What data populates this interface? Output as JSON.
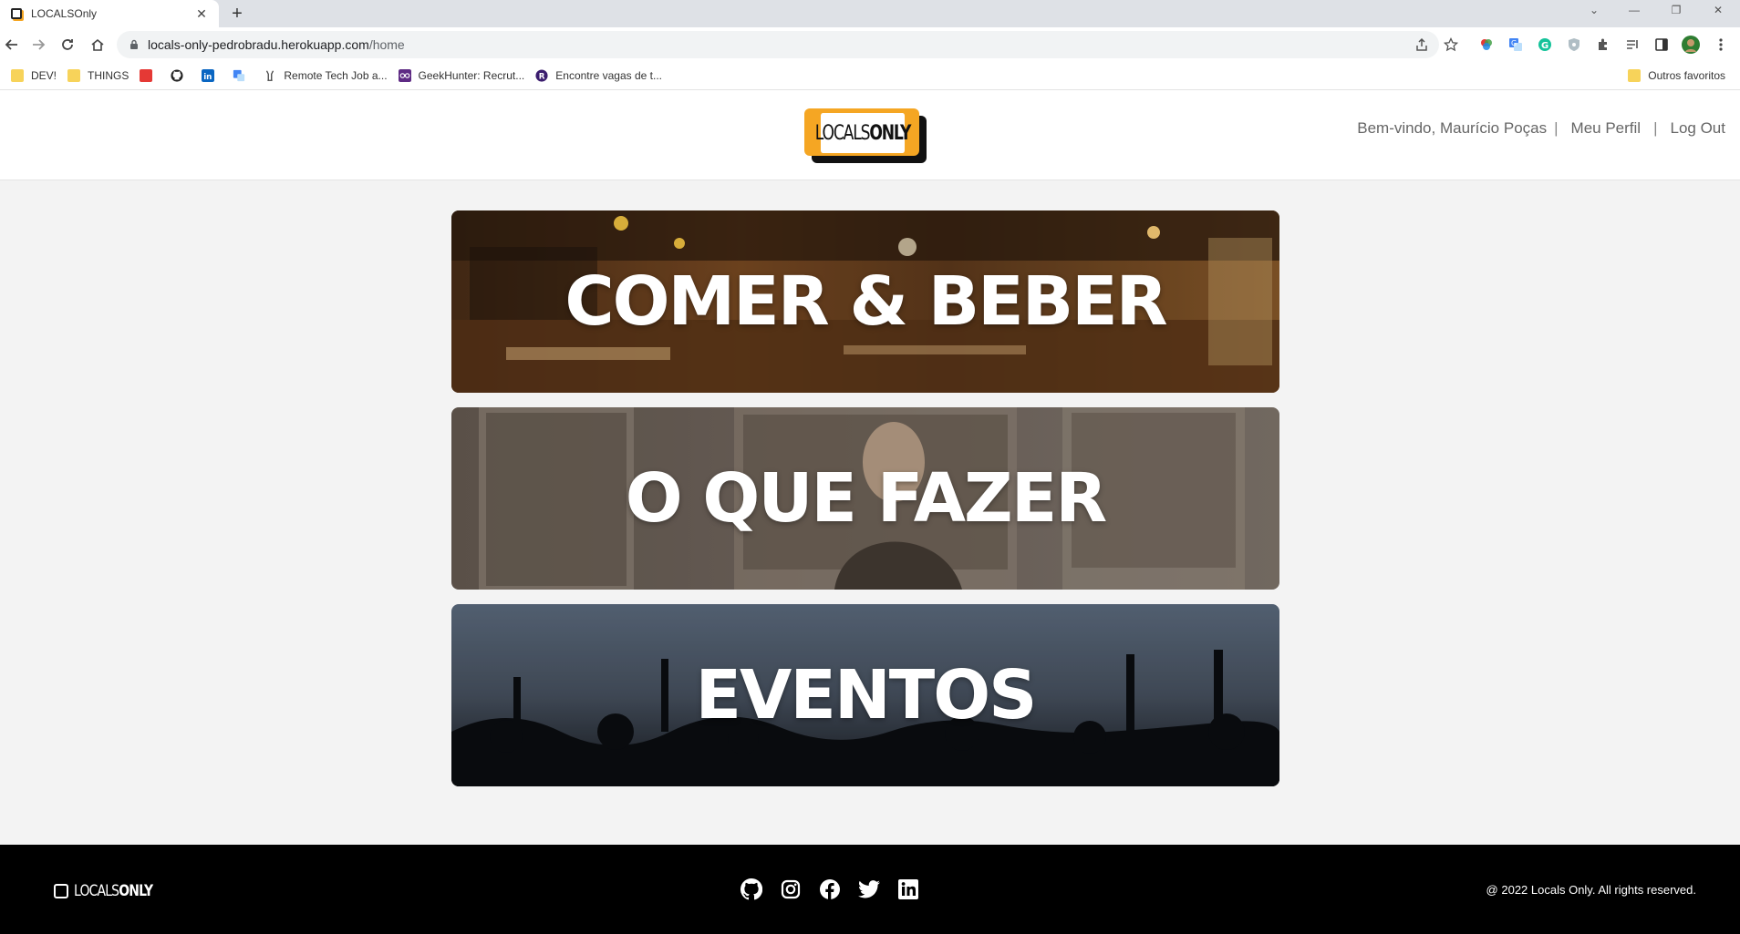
{
  "browser": {
    "tab_title": "LOCALSOnly",
    "url_host": "locals-only-pedrobradu.herokuapp.com",
    "url_path": "/home",
    "bookmarks": [
      {
        "label": "DEV!",
        "icon": "folder-icon"
      },
      {
        "label": "THINGS",
        "icon": "folder-icon"
      },
      {
        "label": "",
        "icon": "red-app-icon"
      },
      {
        "label": "",
        "icon": "github-icon"
      },
      {
        "label": "",
        "icon": "linkedin-icon"
      },
      {
        "label": "",
        "icon": "translate-icon"
      },
      {
        "label": "Remote Tech Job a...",
        "icon": "peace-icon"
      },
      {
        "label": "GeekHunter: Recrut...",
        "icon": "geekhunter-icon"
      },
      {
        "label": "Encontre vagas de t...",
        "icon": "r-logo-icon"
      }
    ],
    "other_bookmarks": "Outros favoritos"
  },
  "header": {
    "logo_left": "LOCALS",
    "logo_right": "ONLY",
    "welcome": "Bem-vindo, Maurício Poças",
    "profile_link": "Meu Perfil",
    "logout_link": "Log Out"
  },
  "cards": [
    {
      "label": "COMER & BEBER"
    },
    {
      "label": "O QUE FAZER"
    },
    {
      "label": "EVENTOS"
    }
  ],
  "footer": {
    "logo_left": "LOCALS",
    "logo_right": "ONLY",
    "social": [
      "github-icon",
      "instagram-icon",
      "facebook-icon",
      "twitter-icon",
      "linkedin-icon"
    ],
    "copyright": "@ 2022 Locals Only. All rights reserved."
  },
  "colors": {
    "brand_orange": "#f5a623",
    "footer_bg": "#000000",
    "page_bg": "#f3f3f3"
  }
}
